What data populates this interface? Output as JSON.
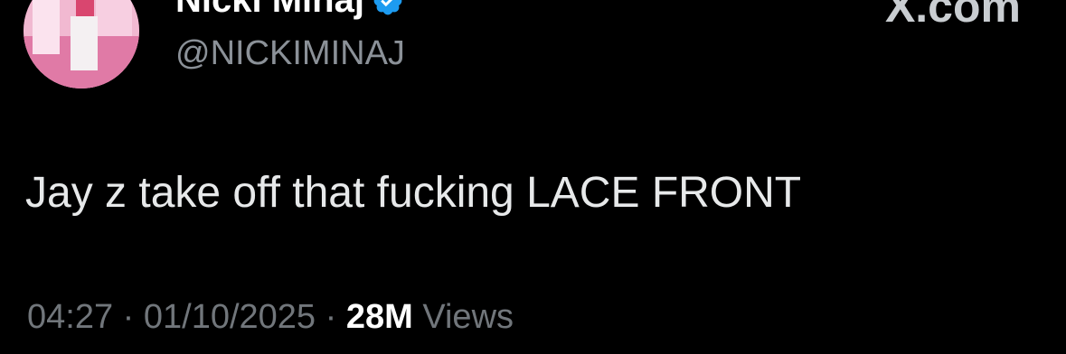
{
  "user": {
    "display_name": "Nicki Minaj",
    "handle": "@NICKIMINAJ",
    "verified": true,
    "avatar_icon": "profile-photo"
  },
  "brand": {
    "label": "X.com"
  },
  "tweet": {
    "text": "Jay z take off that fucking LACE FRONT",
    "time": "04:27",
    "separator": "·",
    "date": "01/10/2025",
    "views_count": "28M",
    "views_label": "Views"
  },
  "colors": {
    "background": "#000000",
    "verified_badge": "#1d9bf0",
    "secondary_text": "#71767b"
  }
}
